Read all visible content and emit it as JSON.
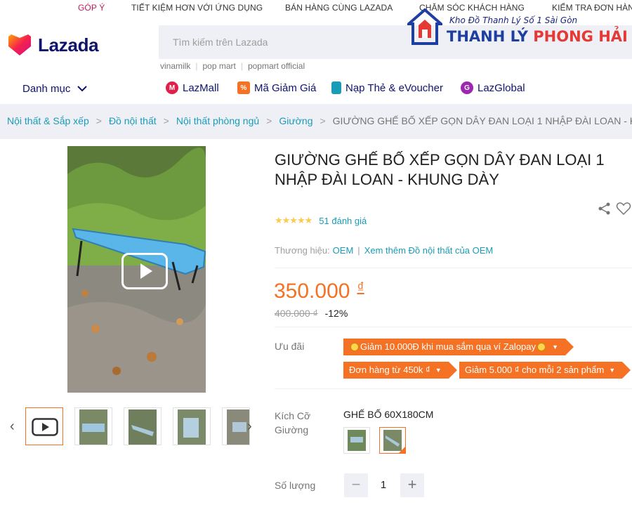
{
  "topbar": {
    "feedback": "GÓP Ý",
    "app_savings": "TIẾT KIỆM HƠN VỚI ỨNG DỤNG",
    "sell": "BÁN HÀNG CÙNG LAZADA",
    "care": "CHĂM SÓC KHÁCH HÀNG",
    "track": "KIỂM TRA ĐƠN HÀNG"
  },
  "header": {
    "logo_text": "Lazada",
    "search_placeholder": "Tìm kiếm trên Lazada",
    "quick_searches": [
      "vinamilk",
      "pop mart",
      "popmart official"
    ]
  },
  "watermark": {
    "subtitle": "Kho Đồ Thanh Lý Số 1 Sài Gòn",
    "title_part1": "THANH LÝ",
    "title_part2": "PHONG HẢI"
  },
  "nav": {
    "categories_label": "Danh mục",
    "items": [
      {
        "label": "LazMall",
        "icon": "lazmall-icon",
        "color": "#e0204a"
      },
      {
        "label": "Mã Giảm Giá",
        "icon": "voucher-icon",
        "color": "#f57224"
      },
      {
        "label": "Nạp Thẻ & eVoucher",
        "icon": "phone-topup-icon",
        "color": "#1a9cb7"
      },
      {
        "label": "LazGlobal",
        "icon": "globe-icon",
        "color": "#9c27b0"
      }
    ]
  },
  "breadcrumb": {
    "items": [
      "Nội thất & Sắp xếp",
      "Đồ nội thất",
      "Nội thất phòng ngủ",
      "Giường"
    ],
    "current": "GIƯỜNG GHẾ BỐ XẾP GỌN DÂY ĐAN LOẠI 1 NHẬP ĐÀI LOAN - K"
  },
  "product": {
    "title": "GIƯỜNG GHẾ BỐ XẾP GỌN DÂY ĐAN LOẠI 1 NHẬP ĐÀI LOAN - KHUNG DÀY",
    "rating_stars": 5,
    "rating_count": "51 đánh giá",
    "brand_label": "Thương hiệu:",
    "brand": "OEM",
    "brand_more": "Xem thêm Đồ nội thất của OEM",
    "price": "350.000",
    "currency": "₫",
    "old_price": "400.000 ₫",
    "discount": "-12%",
    "promo_label": "Ưu đãi",
    "promos": [
      "Giảm 10.000Đ khi mua sắm qua ví Zalopay",
      "Đơn hàng từ 450k ₫",
      "Giảm 5.000 ₫ cho mỗi 2 sản phẩm"
    ],
    "size_label": "Kích Cỡ Giường",
    "size_value": "GHẾ BỐ 60X180CM",
    "qty_label": "Số lượng",
    "qty": "1"
  }
}
